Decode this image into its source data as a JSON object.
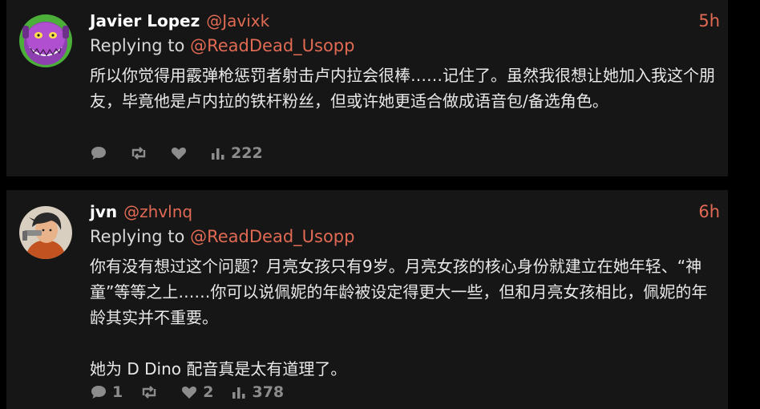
{
  "replies": [
    {
      "name": "Javier Lopez",
      "handle": "@Javixk",
      "time": "5h",
      "replying_prefix": "Replying to",
      "replying_to": "@ReadDead_Usopp",
      "text": "所以你觉得用霰弹枪惩罚者射击卢内拉会很棒……记住了。虽然我很想让她加入我这个朋友，毕竟他是卢内拉的铁杆粉丝，但或许她更适合做成语音包/备选角色。",
      "stats": {
        "comments": "",
        "retweets": "",
        "likes": "",
        "views": "222"
      },
      "accent": "#e06a53"
    },
    {
      "name": "jvn",
      "handle": "@zhvlnq",
      "time": "6h",
      "replying_prefix": "Replying to",
      "replying_to": "@ReadDead_Usopp",
      "text": "你有没有想过这个问题？月亮女孩只有9岁。月亮女孩的核心身份就建立在她年轻、“神童”等等之上……你可以说佩妮的年龄被设定得更大一些，但和月亮女孩相比，佩妮的年龄其实并不重要。\n\n她为 D Dino 配音真是太有道理了。",
      "stats": {
        "comments": "1",
        "retweets": "",
        "likes": "2",
        "views": "378"
      },
      "accent": "#e06a53"
    }
  ],
  "icons": {
    "comment": "comment-icon",
    "retweet": "retweet-icon",
    "like": "heart-icon",
    "views": "views-icon"
  }
}
